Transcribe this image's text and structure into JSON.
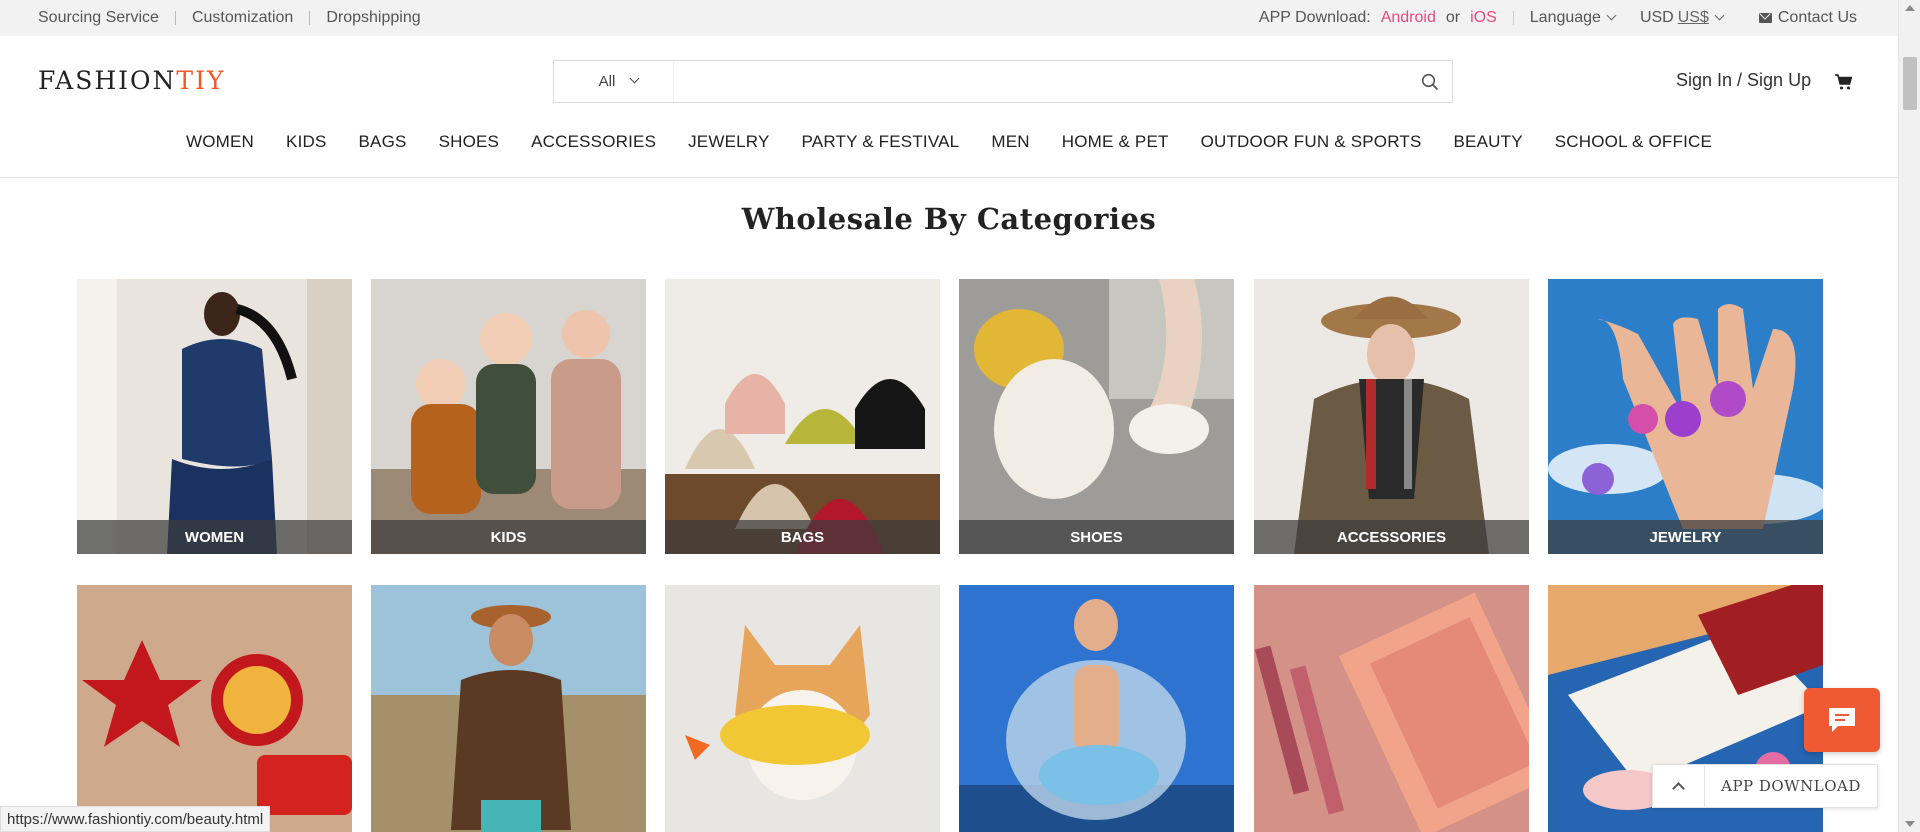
{
  "topbar": {
    "links": [
      "Sourcing Service",
      "Customization",
      "Dropshipping"
    ],
    "app_download_label": "APP Download:",
    "android": "Android",
    "or": "or",
    "ios": "iOS",
    "language": "Language",
    "currency": "USD",
    "currency_symbol": "US$",
    "contact": "Contact Us"
  },
  "header": {
    "logo_main": "FASHION",
    "logo_accent": "TIY",
    "search_category": "All",
    "search_placeholder": "",
    "signin": "Sign In / Sign Up"
  },
  "nav": [
    "WOMEN",
    "KIDS",
    "BAGS",
    "SHOES",
    "ACCESSORIES",
    "JEWELRY",
    "PARTY & FESTIVAL",
    "MEN",
    "HOME & PET",
    "OUTDOOR FUN & SPORTS",
    "BEAUTY",
    "SCHOOL & OFFICE"
  ],
  "main": {
    "title": "Wholesale By Categories",
    "categories": [
      {
        "label": "WOMEN"
      },
      {
        "label": "KIDS"
      },
      {
        "label": "BAGS"
      },
      {
        "label": "SHOES"
      },
      {
        "label": "ACCESSORIES"
      },
      {
        "label": "JEWELRY"
      }
    ]
  },
  "widgets": {
    "app_download": "APP DOWNLOAD",
    "status_url": "https://www.fashiontiy.com/beauty.html"
  },
  "colors": {
    "accent": "#f05a28",
    "pink_link": "#e84a7f",
    "chat": "#f05a32"
  }
}
